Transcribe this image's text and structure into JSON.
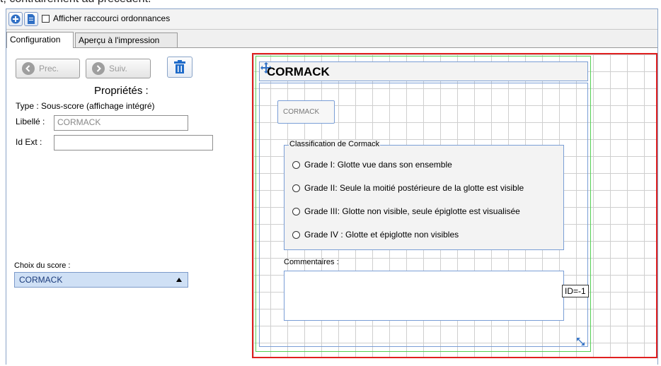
{
  "header_cut_text": "t, contrairement au précédent.",
  "toolbar": {
    "add_icon": "plus-circle-icon",
    "doc_icon": "document-icon",
    "checkbox_label": "Afficher raccourci ordonnances",
    "checkbox_checked": false
  },
  "tabs": [
    {
      "label": "Configuration",
      "active": true
    },
    {
      "label": "Aperçu à l'impression",
      "active": false
    }
  ],
  "nav": {
    "prev_label": "Prec.",
    "next_label": "Suiv.",
    "delete_icon": "trash-icon"
  },
  "properties": {
    "title": "Propriétés :",
    "type_text": "Type : Sous-score (affichage intégré)",
    "libelle_label": "Libellé :",
    "libelle_value": "CORMACK",
    "idext_label": "Id Ext :",
    "idext_value": ""
  },
  "score": {
    "label": "Choix du score :",
    "selected": "CORMACK"
  },
  "preview": {
    "title": "CORMACK",
    "button_label": "CORMACK",
    "group_title": "Classification de Cormack",
    "options": [
      "Grade I:  Glotte vue dans son ensemble",
      "Grade II: Seule la moitié postérieure de la glotte est visible",
      "Grade III: Glotte non visible, seule épiglotte est visualisée",
      "Grade IV : Glotte et épiglotte non visibles"
    ],
    "comments_label": "Commentaires :",
    "comments_value": "",
    "id_badge": "ID=-1"
  },
  "colors": {
    "accent": "#7a9ed6",
    "selection": "#e02020",
    "outline": "#54d054",
    "select_bg": "#cfe0f5"
  }
}
